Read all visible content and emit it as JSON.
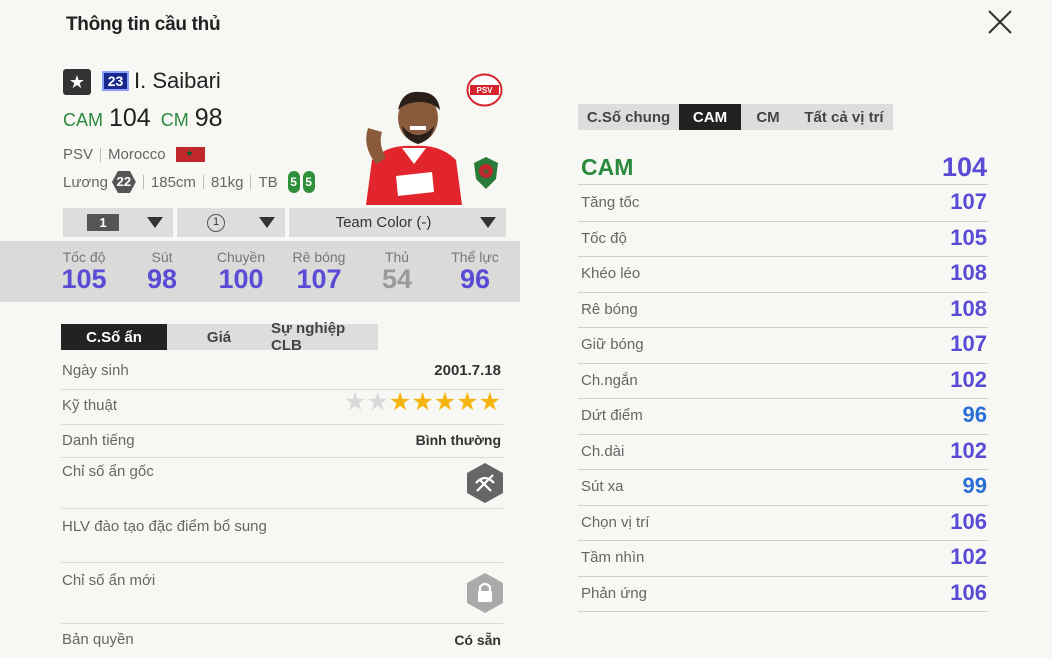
{
  "title": "Thông tin cầu thủ",
  "player": {
    "season_number": "23",
    "name": "I. Saibari",
    "positions": [
      {
        "code": "CAM",
        "value": "104"
      },
      {
        "code": "CM",
        "value": "98"
      }
    ],
    "club": "PSV",
    "nation": "Morocco",
    "salary_label": "Lương",
    "salary": "22",
    "height": "185cm",
    "weight": "81kg",
    "body_type": "TB",
    "weak_foot": "5",
    "strong_foot": "5"
  },
  "dropdowns": {
    "level": "1",
    "grade": "1",
    "team_color": "Team Color (-)"
  },
  "summary_stats": [
    {
      "label": "Tốc độ",
      "value": "105"
    },
    {
      "label": "Sút",
      "value": "98"
    },
    {
      "label": "Chuyền",
      "value": "100"
    },
    {
      "label": "Rê bóng",
      "value": "107"
    },
    {
      "label": "Thủ",
      "value": "54"
    },
    {
      "label": "Thể lực",
      "value": "96"
    }
  ],
  "left_tabs": [
    "C.Số ẩn",
    "Giá",
    "Sự nghiệp CLB"
  ],
  "details": {
    "birthday_label": "Ngày sinh",
    "birthday": "2001.7.18",
    "skill_label": "Kỹ thuật",
    "skill_stars": 5,
    "skill_stars_max": 7,
    "reputation_label": "Danh tiếng",
    "reputation": "Bình thường",
    "original_traits_label": "Chỉ số ẩn gốc",
    "coach_traits_label": "HLV đào tạo đặc điểm bổ sung",
    "new_traits_label": "Chỉ số ẩn mới",
    "license_label": "Bản quyền",
    "license": "Có sẵn"
  },
  "right_tabs": [
    "C.Số chung",
    "CAM",
    "CM",
    "Tất cả vị trí"
  ],
  "position_rating": {
    "label": "CAM",
    "value": "104"
  },
  "attributes": [
    {
      "label": "Tăng tốc",
      "value": "107"
    },
    {
      "label": "Tốc độ",
      "value": "105"
    },
    {
      "label": "Khéo léo",
      "value": "108"
    },
    {
      "label": "Rê bóng",
      "value": "108"
    },
    {
      "label": "Giữ bóng",
      "value": "107"
    },
    {
      "label": "Ch.ngắn",
      "value": "102"
    },
    {
      "label": "Dứt điểm",
      "value": "96"
    },
    {
      "label": "Ch.dài",
      "value": "102"
    },
    {
      "label": "Sút xa",
      "value": "99"
    },
    {
      "label": "Chọn vị trí",
      "value": "106"
    },
    {
      "label": "Tầm nhìn",
      "value": "102"
    },
    {
      "label": "Phản ứng",
      "value": "106"
    }
  ],
  "colors": {
    "position_green": "#2a8a3e",
    "stat_purple": "#5a4bd6",
    "stat_blue": "#2a6fd6",
    "stat_gray": "#9a9a9a"
  }
}
